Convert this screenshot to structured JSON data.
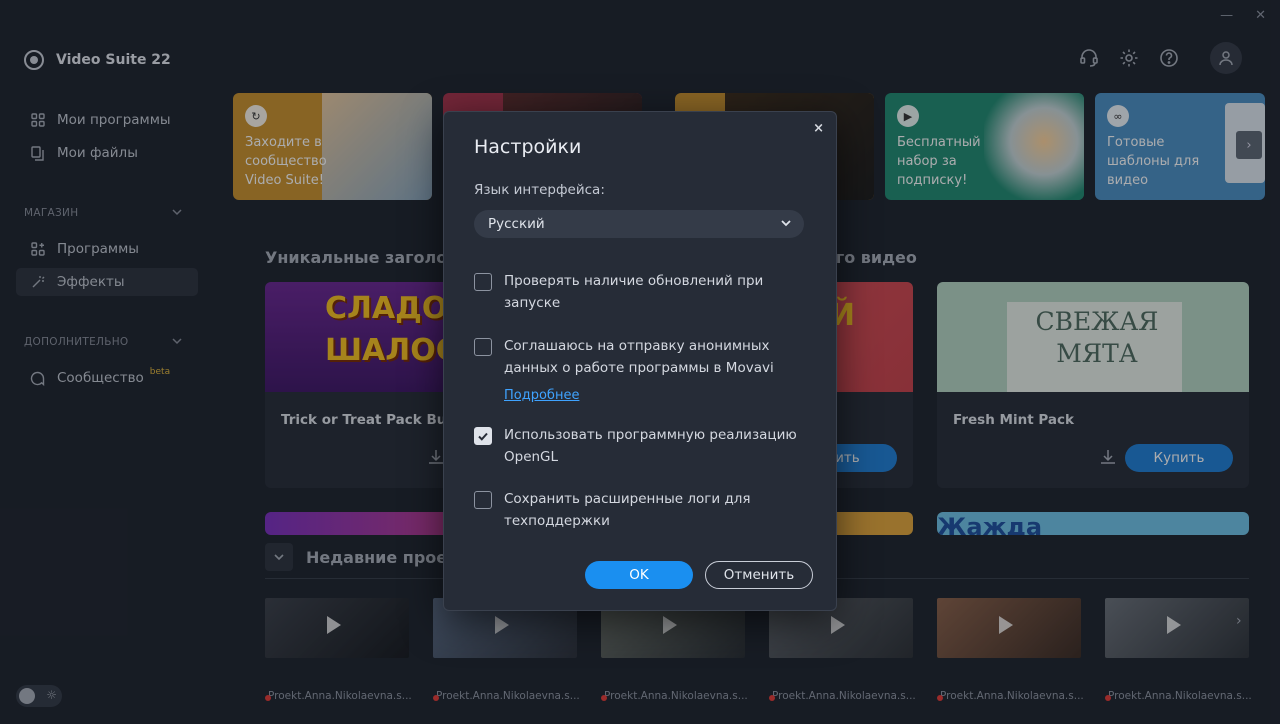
{
  "app": {
    "title": "Video Suite 22"
  },
  "window_controls": {
    "minimize": "—",
    "close": "✕"
  },
  "sidebar": {
    "items_top": [
      {
        "label": "Мои программы",
        "icon": "grid-icon"
      },
      {
        "label": "Мои файлы",
        "icon": "files-icon"
      }
    ],
    "shop_label": "МАГАЗИН",
    "shop_items": [
      {
        "label": "Программы",
        "icon": "apps-icon"
      },
      {
        "label": "Эффекты",
        "icon": "effects-icon",
        "active": true
      }
    ],
    "extra_label": "ДОПОЛНИТЕЛЬНО",
    "extra_items": [
      {
        "label": "Сообщество",
        "badge": "beta",
        "icon": "community-icon"
      }
    ]
  },
  "header": {
    "icons": [
      "headset-icon",
      "gear-icon",
      "help-icon",
      "user-icon"
    ]
  },
  "banners": [
    {
      "text": "Заходите в сообщество Video Suite!",
      "color": "#c9912b"
    },
    {
      "text": "",
      "color": "#a8324a"
    },
    {
      "text": "",
      "color": "#c9912b"
    },
    {
      "text": "Бесплатный набор за подписку!",
      "color": "#1f8a70"
    },
    {
      "text": "Готовые шаблоны для видео",
      "color": "#4a8fc4"
    }
  ],
  "unique_section": {
    "title_left": "Уникальные заголо",
    "title_right": "его видео"
  },
  "cards": [
    {
      "title": "Trick or Treat Pack Bu",
      "image_text": "СЛАДО ИЛИ ШАЛОС",
      "color": "#5a1f7a"
    },
    {
      "title": "",
      "image_text": "Й",
      "buy": "пить",
      "color": "#c9414a"
    },
    {
      "title": "Fresh Mint Pack",
      "image_text": "СВЕЖАЯ МЯТА",
      "buy": "Купить",
      "color": "#a9cdb8"
    }
  ],
  "row2_cards": [
    {
      "image_text": "",
      "color": "#6b2fa8"
    },
    {
      "image_text": "",
      "color": "#c9912b"
    },
    {
      "image_text": "Жажда",
      "color": "#4ab0d8"
    }
  ],
  "recent": {
    "title": "Недавние прое",
    "items": [
      {
        "label": "Proekt.Anna.Nikolaevna.s..."
      },
      {
        "label": "Proekt.Anna.Nikolaevna.s..."
      },
      {
        "label": "Proekt.Anna.Nikolaevna.s..."
      },
      {
        "label": "Proekt.Anna.Nikolaevna.s..."
      },
      {
        "label": "Proekt.Anna.Nikolaevna.s..."
      },
      {
        "label": "Proekt.Anna.Nikolaevna.s..."
      }
    ]
  },
  "modal": {
    "title": "Настройки",
    "close": "×",
    "language_label": "Язык интерфейса:",
    "language_value": "Русский",
    "options": [
      {
        "text": "Проверять наличие обновлений при запуске",
        "checked": false
      },
      {
        "text": "Соглашаюсь на отправку анонимных данных о работе программы в Movavi",
        "checked": false
      },
      {
        "text": "Использовать программную реализацию OpenGL",
        "checked": true
      },
      {
        "text": "Сохранить расширенные логи для техподдержки",
        "checked": false
      }
    ],
    "more_link": "Подробнее",
    "ok": "OK",
    "cancel": "Отменить"
  }
}
